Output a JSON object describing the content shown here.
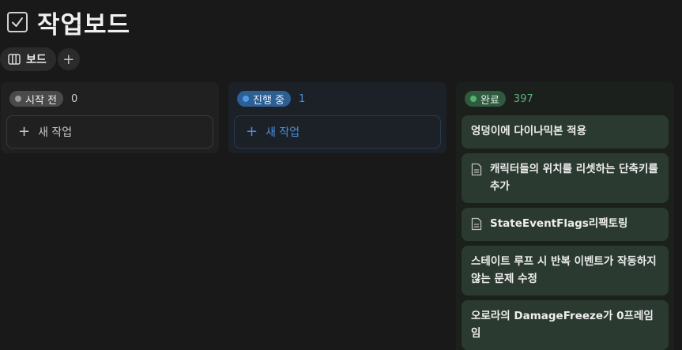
{
  "page": {
    "title": "작업보드",
    "title_icon": "checkbox-icon"
  },
  "views": {
    "active_label": "보드",
    "active_icon": "board-columns-icon",
    "add_label": "+"
  },
  "columns": [
    {
      "status": "시작 전",
      "count": "0",
      "new_task_label": "새 작업",
      "plus": "+"
    },
    {
      "status": "진행 중",
      "count": "1",
      "new_task_label": "새 작업",
      "plus": "+"
    },
    {
      "status": "완료",
      "count": "397"
    }
  ],
  "done_cards": [
    {
      "title": "엉덩이에 다이나믹본 적용",
      "has_doc_icon": false
    },
    {
      "title": "캐릭터들의 위치를 리셋하는 단축키를 추가",
      "has_doc_icon": true
    },
    {
      "title": "StateEventFlags리팩토링",
      "has_doc_icon": true
    },
    {
      "title": "스테이트 루프 시 반복 이벤트가 작동하지 않는 문제 수정",
      "has_doc_icon": false
    },
    {
      "title": "오로라의 DamageFreeze가 0프레임임",
      "has_doc_icon": false
    }
  ],
  "colors": {
    "todo_dot": "#9b9b9b",
    "progress_dot": "#4e9ae8",
    "done_dot": "#4fb36f",
    "card_bg": "#2b3a30"
  }
}
